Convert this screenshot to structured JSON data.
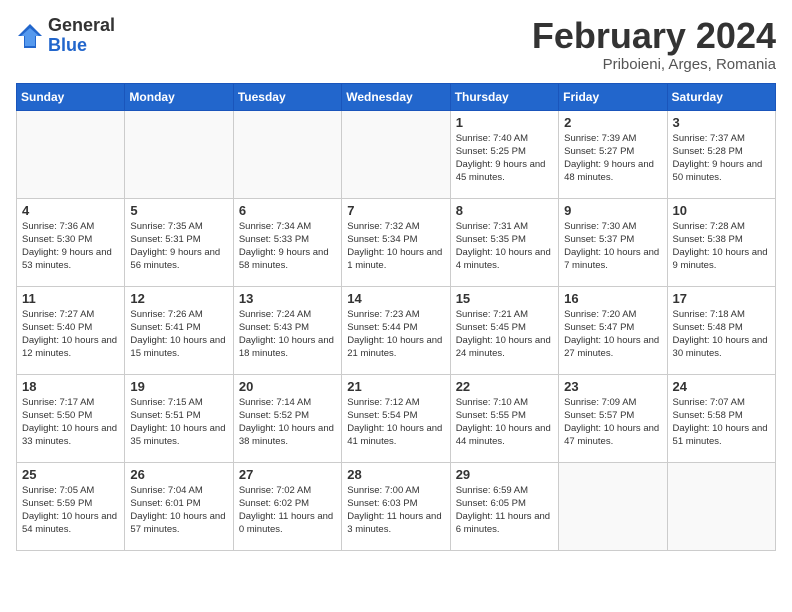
{
  "header": {
    "logo_general": "General",
    "logo_blue": "Blue",
    "title": "February 2024",
    "subtitle": "Priboieni, Arges, Romania"
  },
  "days_of_week": [
    "Sunday",
    "Monday",
    "Tuesday",
    "Wednesday",
    "Thursday",
    "Friday",
    "Saturday"
  ],
  "weeks": [
    [
      {
        "num": "",
        "info": ""
      },
      {
        "num": "",
        "info": ""
      },
      {
        "num": "",
        "info": ""
      },
      {
        "num": "",
        "info": ""
      },
      {
        "num": "1",
        "info": "Sunrise: 7:40 AM\nSunset: 5:25 PM\nDaylight: 9 hours\nand 45 minutes."
      },
      {
        "num": "2",
        "info": "Sunrise: 7:39 AM\nSunset: 5:27 PM\nDaylight: 9 hours\nand 48 minutes."
      },
      {
        "num": "3",
        "info": "Sunrise: 7:37 AM\nSunset: 5:28 PM\nDaylight: 9 hours\nand 50 minutes."
      }
    ],
    [
      {
        "num": "4",
        "info": "Sunrise: 7:36 AM\nSunset: 5:30 PM\nDaylight: 9 hours\nand 53 minutes."
      },
      {
        "num": "5",
        "info": "Sunrise: 7:35 AM\nSunset: 5:31 PM\nDaylight: 9 hours\nand 56 minutes."
      },
      {
        "num": "6",
        "info": "Sunrise: 7:34 AM\nSunset: 5:33 PM\nDaylight: 9 hours\nand 58 minutes."
      },
      {
        "num": "7",
        "info": "Sunrise: 7:32 AM\nSunset: 5:34 PM\nDaylight: 10 hours\nand 1 minute."
      },
      {
        "num": "8",
        "info": "Sunrise: 7:31 AM\nSunset: 5:35 PM\nDaylight: 10 hours\nand 4 minutes."
      },
      {
        "num": "9",
        "info": "Sunrise: 7:30 AM\nSunset: 5:37 PM\nDaylight: 10 hours\nand 7 minutes."
      },
      {
        "num": "10",
        "info": "Sunrise: 7:28 AM\nSunset: 5:38 PM\nDaylight: 10 hours\nand 9 minutes."
      }
    ],
    [
      {
        "num": "11",
        "info": "Sunrise: 7:27 AM\nSunset: 5:40 PM\nDaylight: 10 hours\nand 12 minutes."
      },
      {
        "num": "12",
        "info": "Sunrise: 7:26 AM\nSunset: 5:41 PM\nDaylight: 10 hours\nand 15 minutes."
      },
      {
        "num": "13",
        "info": "Sunrise: 7:24 AM\nSunset: 5:43 PM\nDaylight: 10 hours\nand 18 minutes."
      },
      {
        "num": "14",
        "info": "Sunrise: 7:23 AM\nSunset: 5:44 PM\nDaylight: 10 hours\nand 21 minutes."
      },
      {
        "num": "15",
        "info": "Sunrise: 7:21 AM\nSunset: 5:45 PM\nDaylight: 10 hours\nand 24 minutes."
      },
      {
        "num": "16",
        "info": "Sunrise: 7:20 AM\nSunset: 5:47 PM\nDaylight: 10 hours\nand 27 minutes."
      },
      {
        "num": "17",
        "info": "Sunrise: 7:18 AM\nSunset: 5:48 PM\nDaylight: 10 hours\nand 30 minutes."
      }
    ],
    [
      {
        "num": "18",
        "info": "Sunrise: 7:17 AM\nSunset: 5:50 PM\nDaylight: 10 hours\nand 33 minutes."
      },
      {
        "num": "19",
        "info": "Sunrise: 7:15 AM\nSunset: 5:51 PM\nDaylight: 10 hours\nand 35 minutes."
      },
      {
        "num": "20",
        "info": "Sunrise: 7:14 AM\nSunset: 5:52 PM\nDaylight: 10 hours\nand 38 minutes."
      },
      {
        "num": "21",
        "info": "Sunrise: 7:12 AM\nSunset: 5:54 PM\nDaylight: 10 hours\nand 41 minutes."
      },
      {
        "num": "22",
        "info": "Sunrise: 7:10 AM\nSunset: 5:55 PM\nDaylight: 10 hours\nand 44 minutes."
      },
      {
        "num": "23",
        "info": "Sunrise: 7:09 AM\nSunset: 5:57 PM\nDaylight: 10 hours\nand 47 minutes."
      },
      {
        "num": "24",
        "info": "Sunrise: 7:07 AM\nSunset: 5:58 PM\nDaylight: 10 hours\nand 51 minutes."
      }
    ],
    [
      {
        "num": "25",
        "info": "Sunrise: 7:05 AM\nSunset: 5:59 PM\nDaylight: 10 hours\nand 54 minutes."
      },
      {
        "num": "26",
        "info": "Sunrise: 7:04 AM\nSunset: 6:01 PM\nDaylight: 10 hours\nand 57 minutes."
      },
      {
        "num": "27",
        "info": "Sunrise: 7:02 AM\nSunset: 6:02 PM\nDaylight: 11 hours\nand 0 minutes."
      },
      {
        "num": "28",
        "info": "Sunrise: 7:00 AM\nSunset: 6:03 PM\nDaylight: 11 hours\nand 3 minutes."
      },
      {
        "num": "29",
        "info": "Sunrise: 6:59 AM\nSunset: 6:05 PM\nDaylight: 11 hours\nand 6 minutes."
      },
      {
        "num": "",
        "info": ""
      },
      {
        "num": "",
        "info": ""
      }
    ]
  ]
}
